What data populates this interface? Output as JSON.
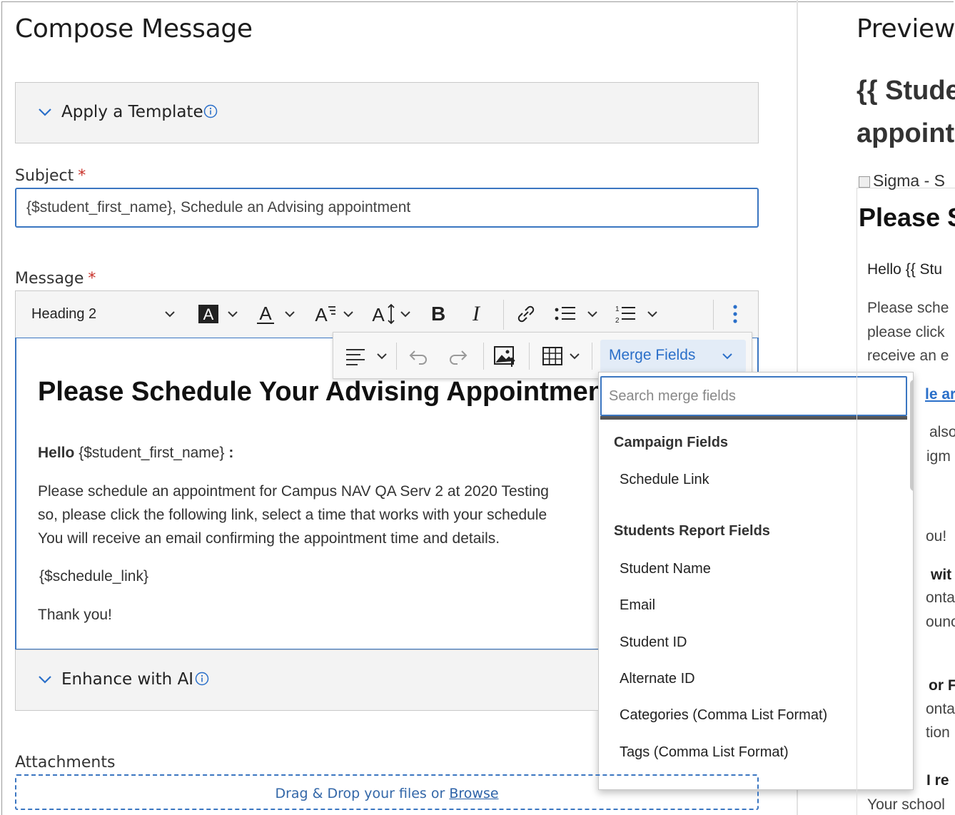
{
  "compose": {
    "title": "Compose Message",
    "template_label": "Apply a Template",
    "subject_label": "Subject",
    "subject_required": "*",
    "subject_value": "{$student_first_name}, Schedule an Advising appointment",
    "message_label": "Message",
    "message_required": "*",
    "toolbar": {
      "heading_select": "Heading 2",
      "bold": "B",
      "italic": "I",
      "font_size": "A"
    },
    "floating_toolbar": {
      "merge_fields_label": "Merge Fields"
    },
    "editor": {
      "heading": "Please Schedule Your Advising Appointment",
      "hello_bold": "Hello",
      "hello_merge": "{$student_first_name}",
      "hello_colon": ":",
      "para_line1": "Please schedule an appointment for Campus NAV QA Serv 2 at 2020 Testing",
      "para_line2": "so, please click the following link, select a time that works with your schedule",
      "para_line3": "You will receive an email confirming the appointment time and details.",
      "schedule_link": "{$schedule_link}",
      "thanks": "Thank you!"
    },
    "enhance_label": "Enhance with AI",
    "attachments_label": "Attachments",
    "attachments_drop_text": "Drag & Drop your files or",
    "attachments_browse": "Browse"
  },
  "merge_dropdown": {
    "search_placeholder": "Search merge fields",
    "groups": [
      {
        "title": "Campaign Fields",
        "items": [
          "Schedule Link"
        ]
      },
      {
        "title": "Students Report Fields",
        "items": [
          "Student Name",
          "Email",
          "Student ID",
          "Alternate ID",
          "Categories (Comma List Format)",
          "Tags (Comma List Format)"
        ]
      }
    ]
  },
  "preview": {
    "title": "Preview",
    "heading_line1": "{{ Stude",
    "heading_line2": "appoint",
    "image_alt": "Sigma - S",
    "h2": "Please S",
    "hello": "Hello {{ Stu",
    "p1": "Please sche",
    "p2": "please click",
    "p3": "receive an e",
    "link": "le ar",
    "f1": "also",
    "f2": "igm",
    "f3": "ou!",
    "f4": "wit",
    "f5": "onta",
    "f6": "ounc",
    "f7": "or F",
    "f8": "onta",
    "f9": "tion",
    "f10": "I re",
    "f11": "Your school"
  },
  "colors": {
    "accent_blue": "#3b76c1",
    "required_red": "#c8322a",
    "merge_button_bg": "#e3ecf7"
  }
}
